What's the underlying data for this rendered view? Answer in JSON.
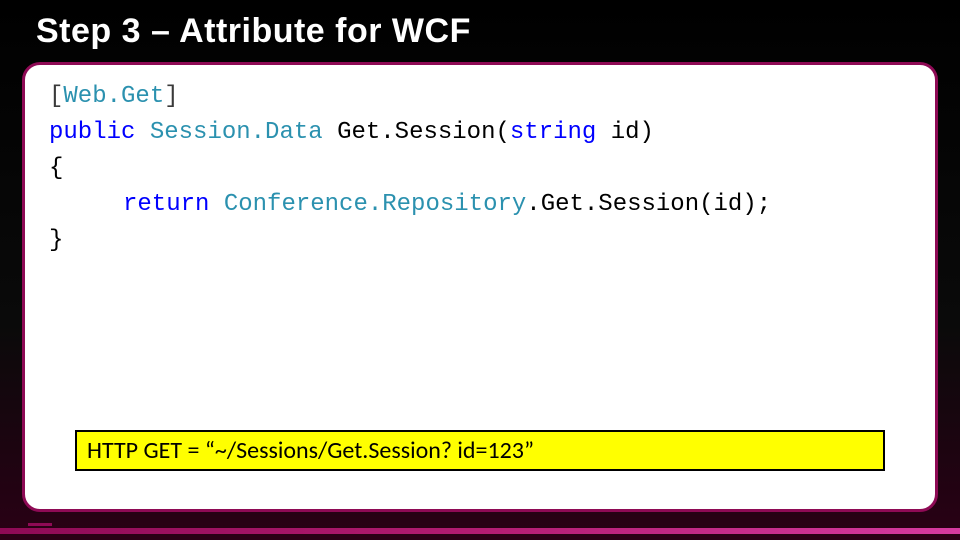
{
  "title": "Step 3 – Attribute for WCF",
  "code": {
    "attr_open": "[",
    "attr_name": "Web.Get",
    "attr_close": "]",
    "kw_public": "public",
    "ret_type": "Session.Data",
    "method_name": "Get.Session",
    "paren_open": "(",
    "kw_string": "string",
    "param_name": "id",
    "paren_close": ")",
    "brace_open": "{",
    "kw_return": "return",
    "repo_type": "Conference.Repository",
    "dot": ".",
    "call_name": "Get.Session",
    "call_args": "(id);",
    "brace_close": "}"
  },
  "highlight": "HTTP GET = “~/Sessions/Get.Session? id=123”"
}
